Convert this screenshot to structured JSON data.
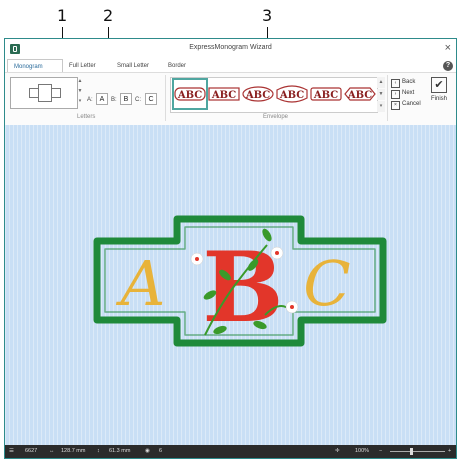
{
  "callouts": [
    "1",
    "2",
    "3"
  ],
  "window": {
    "title": "ExpressMonogram Wizard",
    "close_label": "×",
    "help_label": "?"
  },
  "tabs": [
    {
      "label": "Monogram",
      "active": true
    },
    {
      "label": "Full Letter",
      "active": false
    },
    {
      "label": "Small Letter",
      "active": false
    },
    {
      "label": "Border",
      "active": false
    }
  ],
  "ribbon": {
    "letters_group_label": "Letters",
    "envelope_group_label": "Envelope",
    "letter_fields": [
      {
        "label": "A:",
        "value": "A"
      },
      {
        "label": "B:",
        "value": "B"
      },
      {
        "label": "C:",
        "value": "C"
      }
    ],
    "envelope_thumb_text": "ABC",
    "nav": {
      "back_label": "Back",
      "next_label": "Next",
      "cancel_label": "Cancel"
    },
    "finish_label": "Finish"
  },
  "design": {
    "letters": [
      "A",
      "B",
      "C"
    ],
    "colors": {
      "frame": "#1f8a3a",
      "side_letters": "#e8b33a",
      "center_letter": "#e2362a",
      "leaves": "#3a9a2a",
      "canvas": "#c9dff5"
    }
  },
  "status": {
    "stitches": "6627",
    "width": "128.7 mm",
    "height": "61.3 mm",
    "colors": "6",
    "zoom": "100%"
  }
}
